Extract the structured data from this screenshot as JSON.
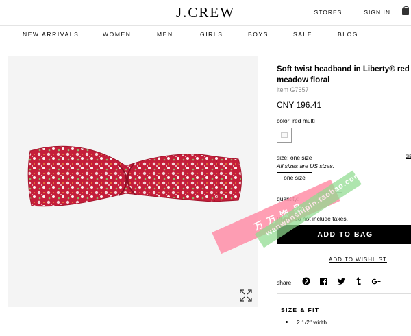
{
  "header": {
    "logo": "J.CREW",
    "links": [
      "STORES",
      "SIGN IN"
    ],
    "bag_icon": "shopping-bag-icon"
  },
  "nav": {
    "items": [
      "NEW ARRIVALS",
      "WOMEN",
      "MEN",
      "GIRLS",
      "BOYS",
      "SALE",
      "BLOG"
    ]
  },
  "product": {
    "title_line1": "Soft twist headband in Liberty® red",
    "title_line2": "meadow floral",
    "item_number": "item G7557",
    "price": "CNY 196.41",
    "color_label": "color:",
    "color_value": "red multi",
    "size_label": "size:",
    "size_value": "one size",
    "size_guide": "size",
    "size_note": "All sizes are US sizes.",
    "size_option": "one size",
    "quantity_label": "quantity:",
    "quantity_value": "1",
    "tax_note": "Prices do not include taxes.",
    "add_to_bag": "ADD TO BAG",
    "add_to_wishlist": "ADD TO WISHLIST",
    "share_label": "share:",
    "share_icons": [
      "pinterest-icon",
      "facebook-icon",
      "twitter-icon",
      "tumblr-icon",
      "google-plus-icon"
    ],
    "size_fit_heading": "SIZE & FIT",
    "size_fit_items": [
      "2 1/2\" width."
    ]
  },
  "watermark": {
    "pink_text": "万 万 饰 品",
    "green_text": "wanwanshipin.taobao.com"
  },
  "colors": {
    "primary": "#000000",
    "muted": "#888888",
    "image_bg": "#f4f4f4",
    "headband_red": "#c41e3a"
  }
}
